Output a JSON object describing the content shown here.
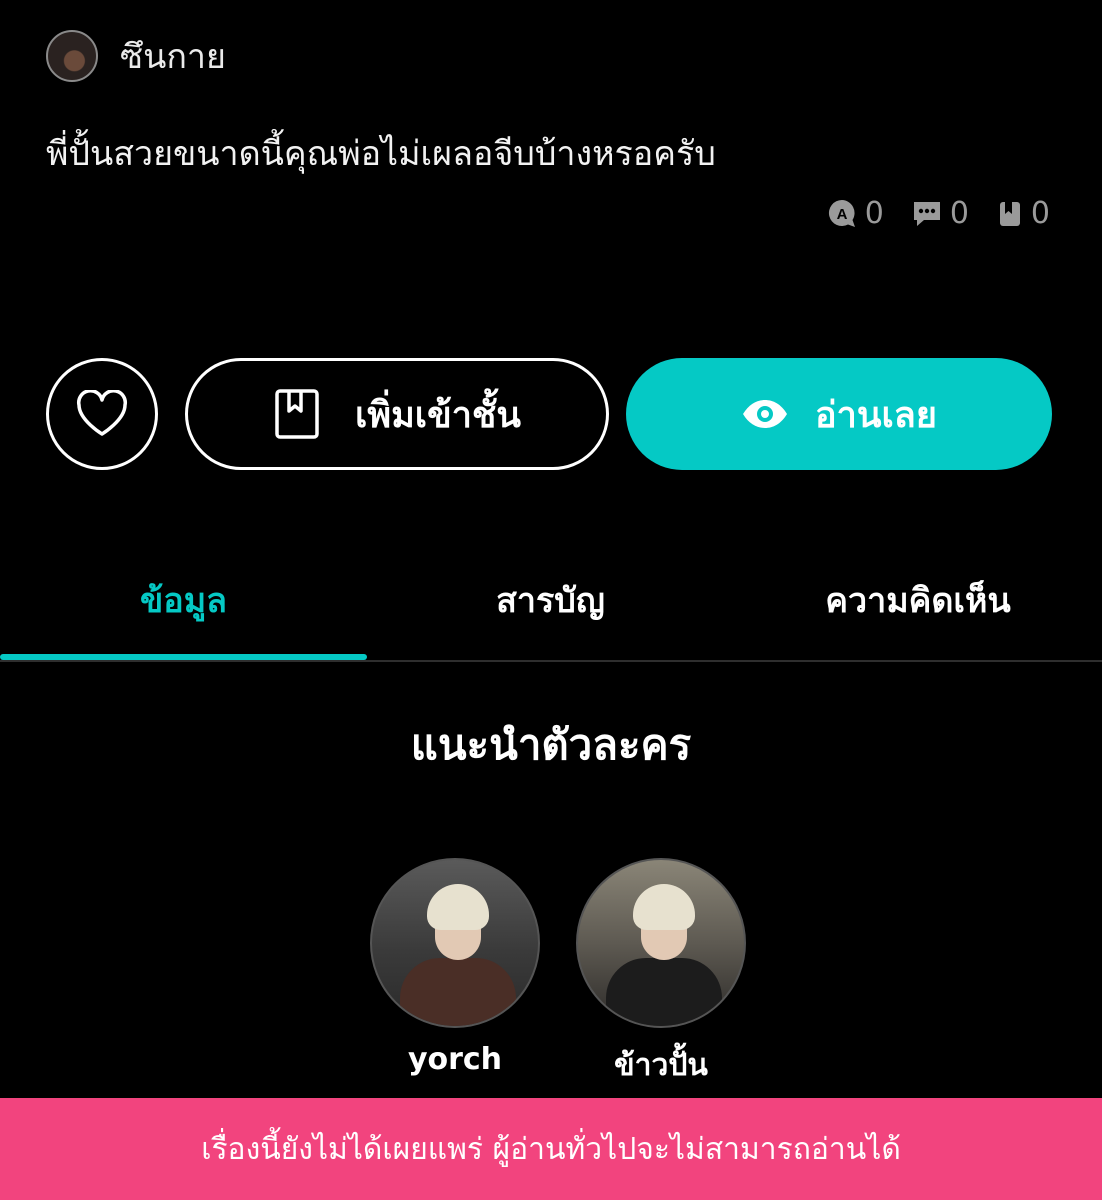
{
  "author": {
    "name": "ซึนกาย"
  },
  "story": {
    "subtitle": "พี่ปั้นสวยขนาดนี้คุณพ่อไม่เผลอจีบบ้างหรอครับ"
  },
  "stats": [
    {
      "icon": "chat-a-icon",
      "value": "0"
    },
    {
      "icon": "comment-icon",
      "value": "0"
    },
    {
      "icon": "bookmark-icon",
      "value": "0"
    }
  ],
  "actions": {
    "add_shelf_label": "เพิ่มเข้าชั้น",
    "read_label": "อ่านเลย"
  },
  "tabs": [
    {
      "label": "ข้อมูล",
      "active": true
    },
    {
      "label": "สารบัญ",
      "active": false
    },
    {
      "label": "ความคิดเห็น",
      "active": false
    }
  ],
  "section": {
    "title": "แนะนำตัวละคร"
  },
  "characters": [
    {
      "name": "yorch"
    },
    {
      "name": "ข้าวปั้น"
    }
  ],
  "banner": {
    "text": "เรื่องนี้ยังไม่ได้เผยแพร่ ผู้อ่านทั่วไปจะไม่สามารถอ่านได้"
  },
  "colors": {
    "accent": "#05c9c5",
    "banner": "#f2447e",
    "background": "#000000"
  }
}
